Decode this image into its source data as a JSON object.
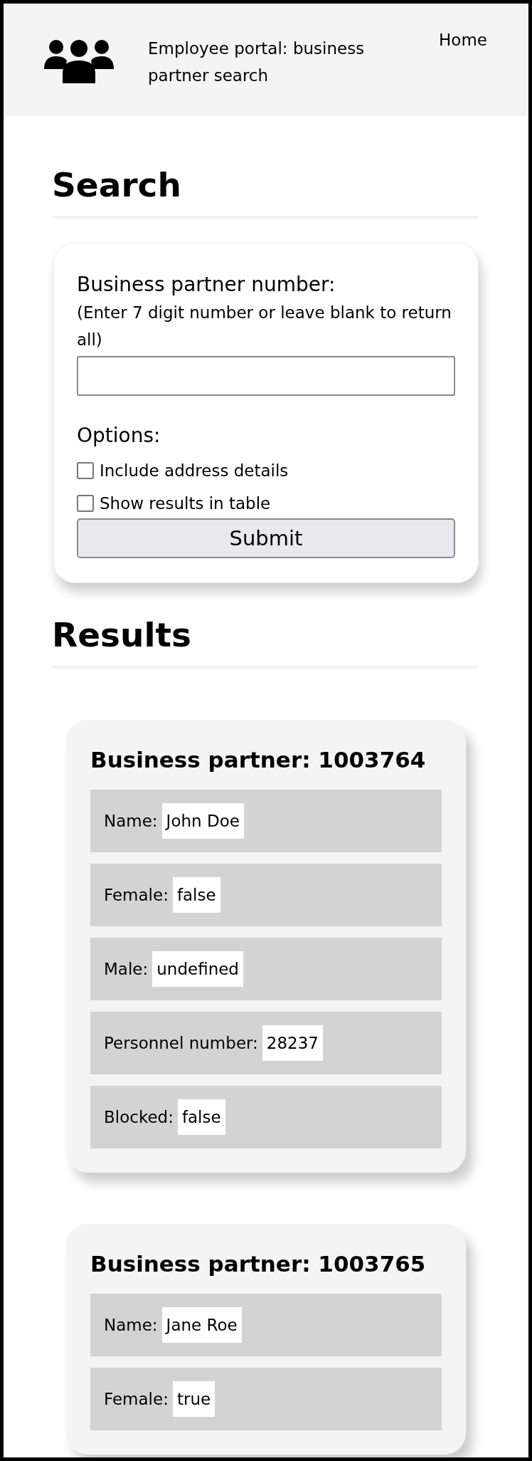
{
  "header": {
    "title": "Employee portal: business partner search",
    "nav": [
      {
        "label": "Home"
      }
    ]
  },
  "search": {
    "heading": "Search",
    "field_label": "Business partner number:",
    "field_hint": "(Enter 7 digit number or leave blank to return all)",
    "options_label": "Options:",
    "options": [
      {
        "label": "Include address details",
        "checked": false
      },
      {
        "label": "Show results in table",
        "checked": false
      }
    ],
    "submit": "Submit"
  },
  "results": {
    "heading": "Results",
    "partners": [
      {
        "title": "Business partner: 1003764",
        "fields": [
          {
            "label": "Name:",
            "value": "John Doe"
          },
          {
            "label": "Female:",
            "value": "false"
          },
          {
            "label": "Male:",
            "value": "undefined"
          },
          {
            "label": "Personnel number:",
            "value": "28237"
          },
          {
            "label": "Blocked:",
            "value": "false"
          }
        ]
      },
      {
        "title": "Business partner: 1003765",
        "fields": [
          {
            "label": "Name:",
            "value": "Jane Roe"
          },
          {
            "label": "Female:",
            "value": "true"
          }
        ]
      }
    ]
  }
}
